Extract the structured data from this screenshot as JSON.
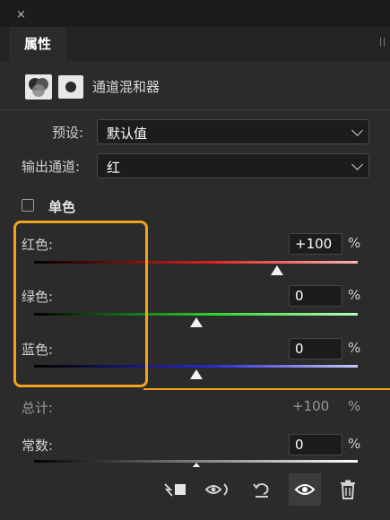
{
  "window": {
    "close_glyph": "×"
  },
  "tabs": [
    {
      "label": "属性"
    }
  ],
  "panel": {
    "title": "通道混和器",
    "adjustment_icon": "channel-mixer-icon",
    "mask_icon": "layer-mask-icon"
  },
  "preset": {
    "label": "预设:",
    "value": "默认值"
  },
  "output_channel": {
    "label": "输出通道:",
    "value": "红"
  },
  "monochrome": {
    "label": "单色",
    "checked": false
  },
  "sliders": [
    {
      "label": "红色:",
      "value": "+100",
      "unit": "%",
      "numeric": 100,
      "gradient_end": "#ffb3b3",
      "gradient_mid": "#e02020"
    },
    {
      "label": "绿色:",
      "value": "0",
      "unit": "%",
      "numeric": 0,
      "gradient_end": "#b8ffb8",
      "gradient_mid": "#2cd42c"
    },
    {
      "label": "蓝色:",
      "value": "0",
      "unit": "%",
      "numeric": 0,
      "gradient_end": "#c9c9ff",
      "gradient_mid": "#2a2ad0"
    }
  ],
  "total": {
    "label": "总计:",
    "value": "+100",
    "unit": "%"
  },
  "constant": {
    "label": "常数:",
    "value": "0",
    "unit": "%",
    "numeric": 0
  },
  "toolbar": {
    "buttons": [
      {
        "name": "clip-to-layer-icon",
        "glyph": "↯■"
      },
      {
        "name": "view-previous-state-icon",
        "glyph": "◎"
      },
      {
        "name": "reset-icon",
        "glyph": "↺"
      },
      {
        "name": "toggle-visibility-icon",
        "glyph": "◉"
      },
      {
        "name": "delete-icon",
        "glyph": "🗑"
      }
    ]
  },
  "colors": {
    "highlight": "#f4a21c",
    "panel_bg": "#2b2b2b"
  }
}
